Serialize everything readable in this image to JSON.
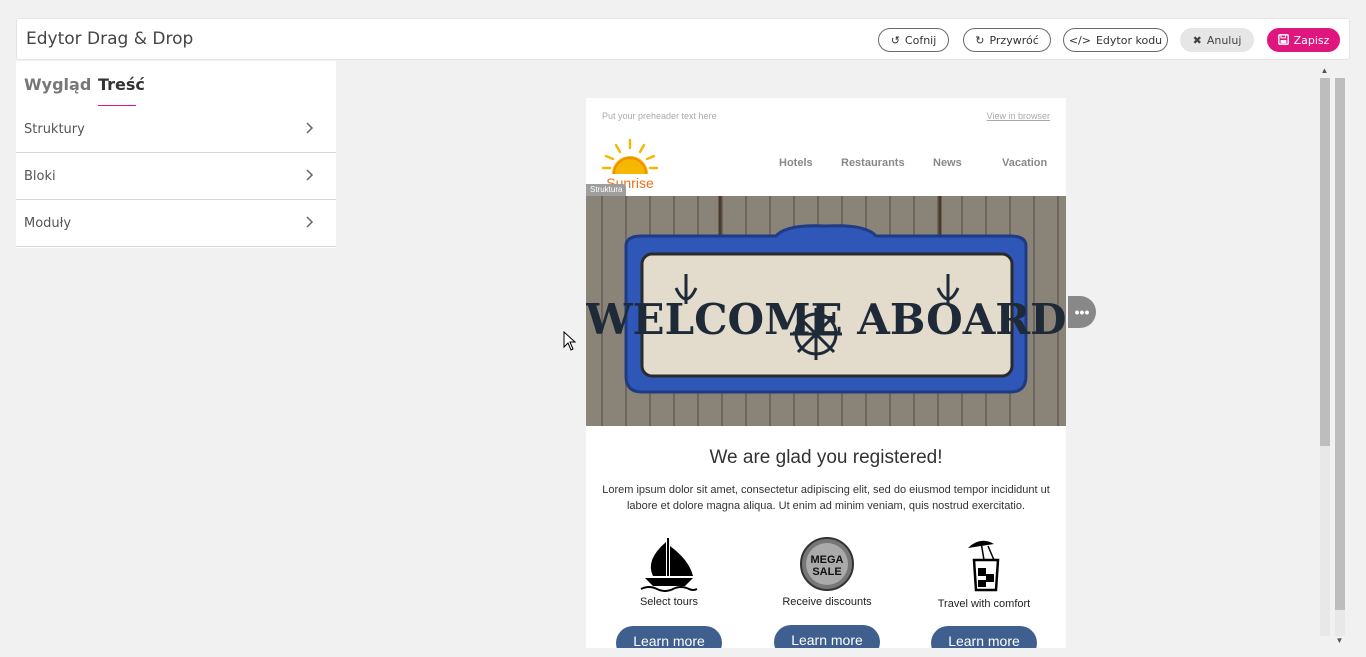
{
  "header": {
    "title": "Edytor Drag & Drop",
    "buttons": {
      "undo": "Cofnij",
      "redo": "Przywróć",
      "code_editor": "Edytor kodu",
      "cancel": "Anuluj",
      "save": "Zapisz"
    },
    "icons": {
      "undo": "undo-icon",
      "redo": "redo-icon",
      "code": "code-icon",
      "cancel": "close-icon",
      "save": "floppy-disk-icon"
    },
    "accent_color": "#e0167f"
  },
  "sidebar": {
    "tabs": [
      {
        "label": "Wygląd",
        "active": false
      },
      {
        "label": "Treść",
        "active": true
      }
    ],
    "items": [
      {
        "label": "Struktury",
        "icon": "chevron-right-icon"
      },
      {
        "label": "Bloki",
        "icon": "chevron-right-icon"
      },
      {
        "label": "Moduły",
        "icon": "chevron-right-icon"
      }
    ]
  },
  "email": {
    "preheader": "Put your preheader text here",
    "view_in_browser": "View in browser",
    "logo_text": "Sunrise",
    "nav": [
      "Hotels",
      "Restaurants",
      "News",
      "Vacation"
    ],
    "structure_badge": "Struktura",
    "hero_text": "WELCOME ABOARD",
    "headline": "We are glad you registered!",
    "body": "Lorem ipsum dolor sit amet, consectetur adipiscing elit, sed do eiusmod tempor incididunt ut labore et dolore magna aliqua. Ut enim ad minim veniam, quis nostrud exercitatio.",
    "features": [
      {
        "label": "Select tours",
        "icon": "sailboat-icon",
        "button": "Learn more"
      },
      {
        "label": "Receive discounts",
        "icon": "mega-sale-badge-icon",
        "badge_text_1": "MEGA",
        "badge_text_2": "SALE",
        "button": "Learn more"
      },
      {
        "label": "Travel with comfort",
        "icon": "cocktail-icon",
        "button": "Learn more"
      }
    ],
    "button_color": "#3f5f8f"
  },
  "canvas": {
    "side_handle_label": "•••"
  }
}
